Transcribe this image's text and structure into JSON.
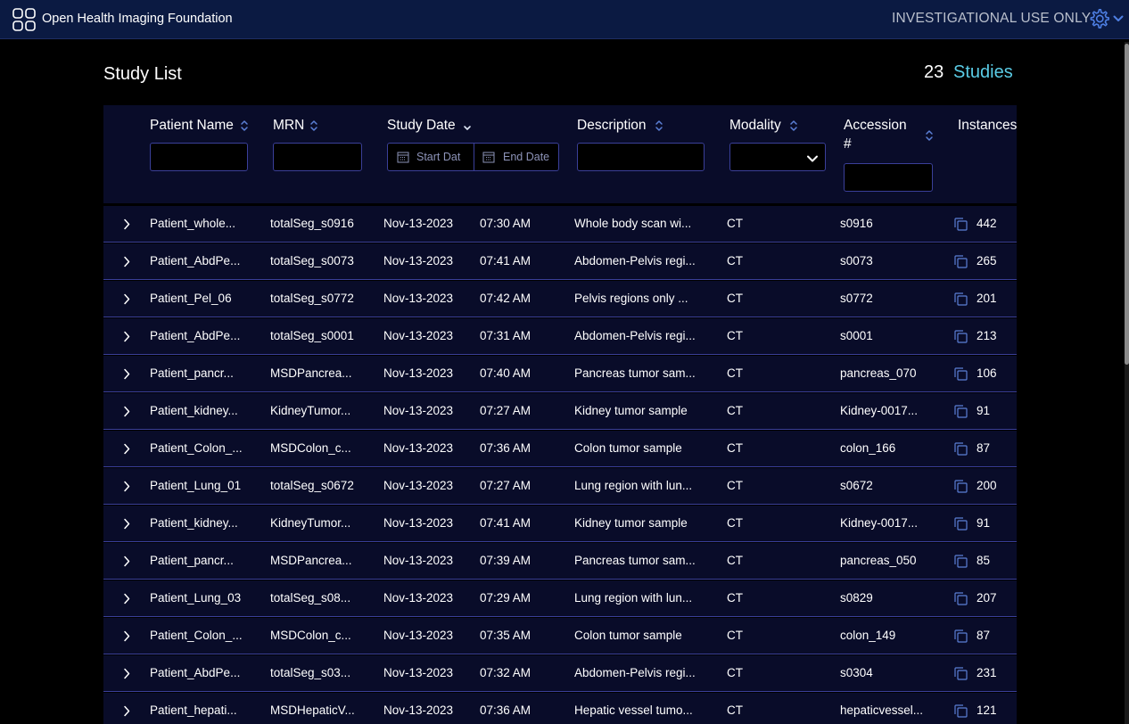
{
  "header": {
    "logo_text": "Open Health Imaging Foundation",
    "notice": "INVESTIGATIONAL USE ONLY",
    "icons": [
      "ohif-logo-icon",
      "gear-icon",
      "chevron-down-icon"
    ]
  },
  "study_list": {
    "title": "Study List",
    "count": "23",
    "count_label": "Studies"
  },
  "columns": {
    "patient_name": "Patient Name",
    "mrn": "MRN",
    "study_date": "Study Date",
    "description": "Description",
    "modality": "Modality",
    "accession_line1": "Accession",
    "accession_line2": "#",
    "instances": "Instances"
  },
  "filters": {
    "patient_name": "",
    "mrn": "",
    "start_date_placeholder": "Start Dat",
    "end_date_placeholder": "End Date",
    "description": "",
    "modality": "",
    "accession": ""
  },
  "colors": {
    "header_bg": "#0b1a42",
    "row_bg": "#090c29",
    "accent": "#5acce6",
    "border": "#3a3f99",
    "sort_icon": "#5b7fd6"
  },
  "studies": [
    {
      "patient": "Patient_whole...",
      "mrn": "totalSeg_s0916",
      "date": "Nov-13-2023",
      "time": "07:30 AM",
      "description": "Whole body scan wi...",
      "modality": "CT",
      "accession": "s0916",
      "instances": "442"
    },
    {
      "patient": "Patient_AbdPe...",
      "mrn": "totalSeg_s0073",
      "date": "Nov-13-2023",
      "time": "07:41 AM",
      "description": "Abdomen-Pelvis regi...",
      "modality": "CT",
      "accession": "s0073",
      "instances": "265"
    },
    {
      "patient": "Patient_Pel_06",
      "mrn": "totalSeg_s0772",
      "date": "Nov-13-2023",
      "time": "07:42 AM",
      "description": "Pelvis regions only ...",
      "modality": "CT",
      "accession": "s0772",
      "instances": "201"
    },
    {
      "patient": "Patient_AbdPe...",
      "mrn": "totalSeg_s0001",
      "date": "Nov-13-2023",
      "time": "07:31 AM",
      "description": "Abdomen-Pelvis regi...",
      "modality": "CT",
      "accession": "s0001",
      "instances": "213"
    },
    {
      "patient": "Patient_pancr...",
      "mrn": "MSDPancrea...",
      "date": "Nov-13-2023",
      "time": "07:40 AM",
      "description": "Pancreas tumor sam...",
      "modality": "CT",
      "accession": "pancreas_070",
      "instances": "106"
    },
    {
      "patient": "Patient_kidney...",
      "mrn": "KidneyTumor...",
      "date": "Nov-13-2023",
      "time": "07:27 AM",
      "description": "Kidney tumor sample",
      "modality": "CT",
      "accession": "Kidney-0017...",
      "instances": "91"
    },
    {
      "patient": "Patient_Colon_...",
      "mrn": "MSDColon_c...",
      "date": "Nov-13-2023",
      "time": "07:36 AM",
      "description": "Colon tumor sample",
      "modality": "CT",
      "accession": "colon_166",
      "instances": "87"
    },
    {
      "patient": "Patient_Lung_01",
      "mrn": "totalSeg_s0672",
      "date": "Nov-13-2023",
      "time": "07:27 AM",
      "description": "Lung region with lun...",
      "modality": "CT",
      "accession": "s0672",
      "instances": "200"
    },
    {
      "patient": "Patient_kidney...",
      "mrn": "KidneyTumor...",
      "date": "Nov-13-2023",
      "time": "07:41 AM",
      "description": "Kidney tumor sample",
      "modality": "CT",
      "accession": "Kidney-0017...",
      "instances": "91"
    },
    {
      "patient": "Patient_pancr...",
      "mrn": "MSDPancrea...",
      "date": "Nov-13-2023",
      "time": "07:39 AM",
      "description": "Pancreas tumor sam...",
      "modality": "CT",
      "accession": "pancreas_050",
      "instances": "85"
    },
    {
      "patient": "Patient_Lung_03",
      "mrn": "totalSeg_s08...",
      "date": "Nov-13-2023",
      "time": "07:29 AM",
      "description": "Lung region with lun...",
      "modality": "CT",
      "accession": "s0829",
      "instances": "207"
    },
    {
      "patient": "Patient_Colon_...",
      "mrn": "MSDColon_c...",
      "date": "Nov-13-2023",
      "time": "07:35 AM",
      "description": "Colon tumor sample",
      "modality": "CT",
      "accession": "colon_149",
      "instances": "87"
    },
    {
      "patient": "Patient_AbdPe...",
      "mrn": "totalSeg_s03...",
      "date": "Nov-13-2023",
      "time": "07:32 AM",
      "description": "Abdomen-Pelvis regi...",
      "modality": "CT",
      "accession": "s0304",
      "instances": "231"
    },
    {
      "patient": "Patient_hepati...",
      "mrn": "MSDHepaticV...",
      "date": "Nov-13-2023",
      "time": "07:36 AM",
      "description": "Hepatic vessel tumo...",
      "modality": "CT",
      "accession": "hepaticvessel...",
      "instances": "121"
    }
  ]
}
